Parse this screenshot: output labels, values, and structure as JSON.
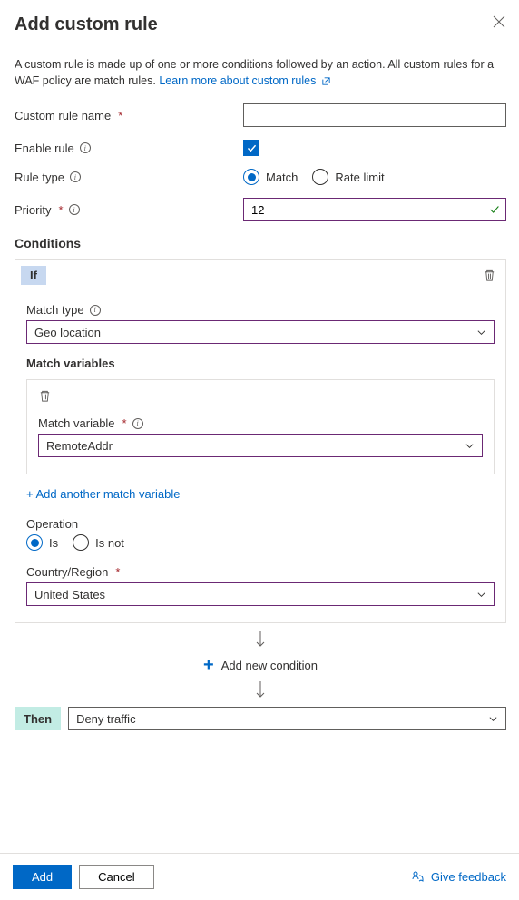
{
  "header": {
    "title": "Add custom rule"
  },
  "description": {
    "text": "A custom rule is made up of one or more conditions followed by an action. All custom rules for a WAF policy are match rules. ",
    "link_text": "Learn more about custom rules"
  },
  "fields": {
    "custom_rule_name": {
      "label": "Custom rule name",
      "value": ""
    },
    "enable_rule": {
      "label": "Enable rule"
    },
    "rule_type": {
      "label": "Rule type",
      "options": {
        "match": "Match",
        "rate_limit": "Rate limit"
      }
    },
    "priority": {
      "label": "Priority",
      "value": "12"
    }
  },
  "conditions": {
    "heading": "Conditions",
    "if_label": "If",
    "match_type": {
      "label": "Match type",
      "value": "Geo location"
    },
    "match_variables_heading": "Match variables",
    "match_variable": {
      "label": "Match variable",
      "value": "RemoteAddr"
    },
    "add_variable_link": "+ Add another match variable",
    "operation": {
      "label": "Operation",
      "options": {
        "is": "Is",
        "is_not": "Is not"
      }
    },
    "country": {
      "label": "Country/Region",
      "value": "United States"
    },
    "add_condition": "Add new condition"
  },
  "then": {
    "label": "Then",
    "action": "Deny traffic"
  },
  "footer": {
    "add": "Add",
    "cancel": "Cancel",
    "feedback": "Give feedback"
  }
}
